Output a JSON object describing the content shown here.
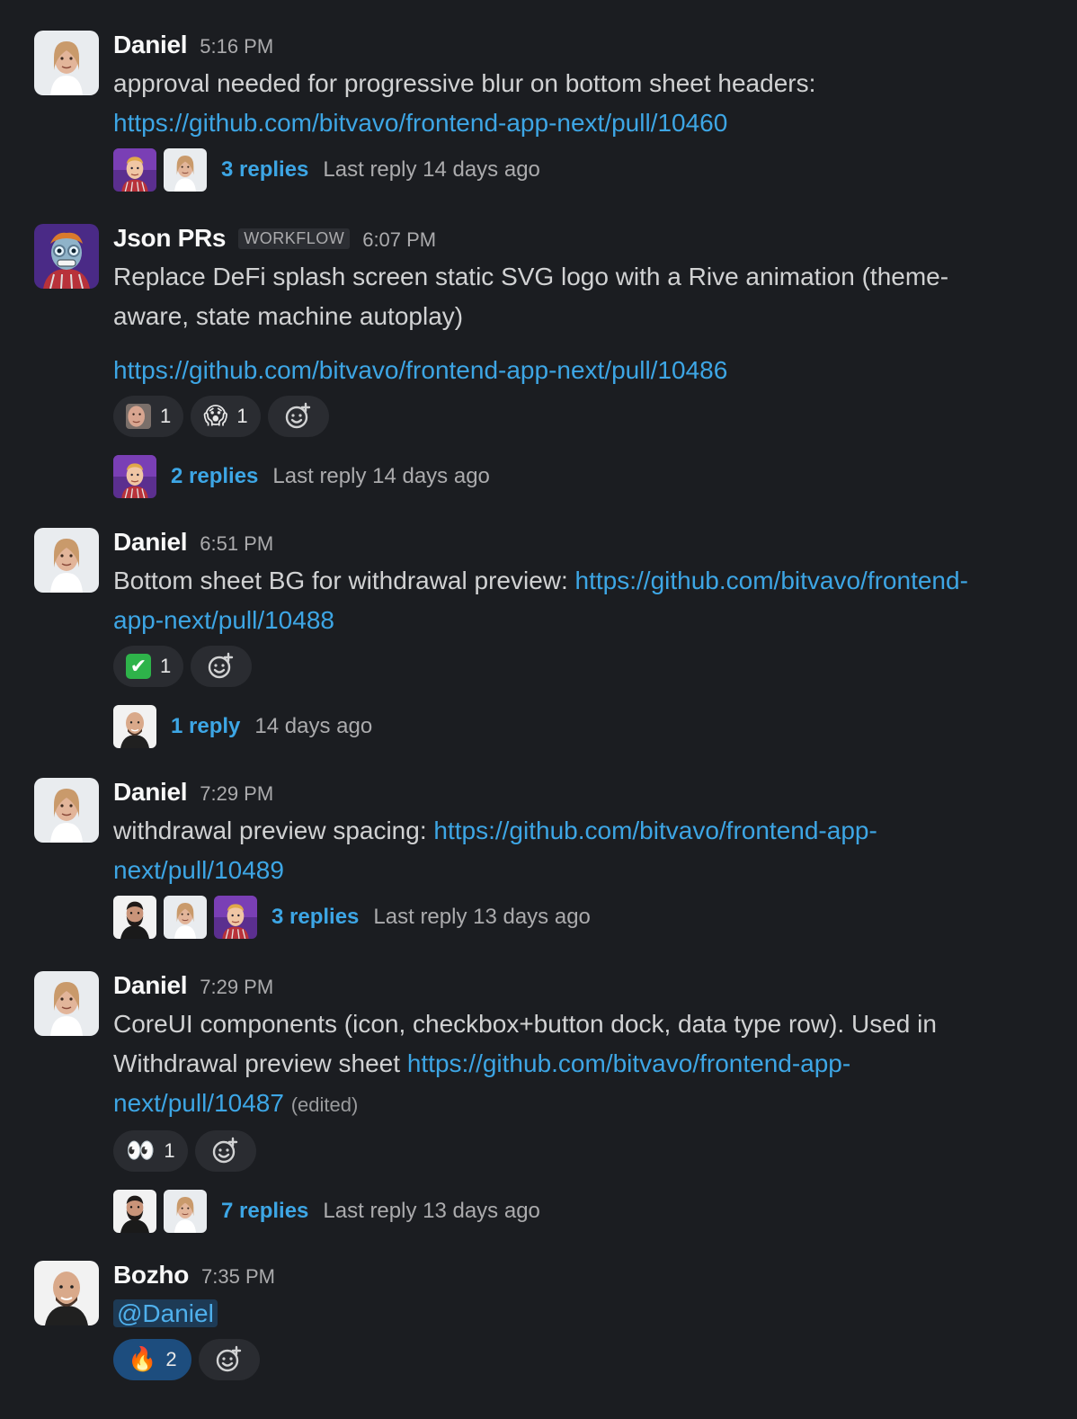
{
  "messages": [
    {
      "author": "Daniel",
      "time": "5:16 PM",
      "text_lines": [
        "approval needed for progressive blur on bottom sheet headers:"
      ],
      "link": "https://github.com/bitvavo/frontend-app-next/pull/10460",
      "thread": {
        "avatars": [
          "bad-luck-avatar",
          "daniel-avatar"
        ],
        "replies": "3 replies",
        "last": "Last reply 14 days ago"
      }
    },
    {
      "author": "Json PRs",
      "badge": "WORKFLOW",
      "time": "6:07 PM",
      "text_line1": "Replace DeFi splash screen static SVG logo with a Rive animation (theme-",
      "text_line2": "aware, state machine autoplay)",
      "link": "https://github.com/bitvavo/frontend-app-next/pull/10486",
      "reactions": [
        {
          "emoji": "face-avatar",
          "count": "1"
        },
        {
          "emoji": "😱",
          "count": "1"
        }
      ],
      "thread": {
        "avatars": [
          "bad-luck-avatar"
        ],
        "replies": "2 replies",
        "last": "Last reply 14 days ago"
      }
    },
    {
      "author": "Daniel",
      "time": "6:51 PM",
      "text_prefix": "Bottom sheet BG for withdrawal preview: ",
      "link_part1": "https://github.com/bitvavo/frontend-",
      "link_part2": "app-next/pull/10488",
      "reactions": [
        {
          "emoji": "✔",
          "count": "1"
        }
      ],
      "thread": {
        "avatars": [
          "bozho-avatar"
        ],
        "replies": "1 reply",
        "last": "14 days ago"
      }
    },
    {
      "author": "Daniel",
      "time": "7:29 PM",
      "text_prefix": "withdrawal preview spacing: ",
      "link_part1": "https://github.com/bitvavo/frontend-app-",
      "link_part2": "next/pull/10489",
      "thread": {
        "avatars": [
          "beard-avatar",
          "daniel-avatar",
          "bad-luck-avatar"
        ],
        "replies": "3 replies",
        "last": "Last reply 13 days ago"
      }
    },
    {
      "author": "Daniel",
      "time": "7:29 PM",
      "text_line1": "CoreUI components (icon, checkbox+button dock, data type row). Used in",
      "text_prefix": "Withdrawal preview sheet ",
      "link_part1": "https://github.com/bitvavo/frontend-app-",
      "link_part2": "next/pull/10487",
      "edited": "(edited)",
      "reactions": [
        {
          "emoji": "👀",
          "count": "1"
        }
      ],
      "thread": {
        "avatars": [
          "beard-avatar",
          "daniel-avatar"
        ],
        "replies": "7 replies",
        "last": "Last reply 13 days ago"
      }
    },
    {
      "author": "Bozho",
      "time": "7:35 PM",
      "mention": "@Daniel",
      "reactions": [
        {
          "emoji": "🔥",
          "count": "2"
        }
      ]
    }
  ],
  "colors": {
    "background": "#1b1d21",
    "link": "#3da6e5",
    "text": "#d1d2d3"
  }
}
